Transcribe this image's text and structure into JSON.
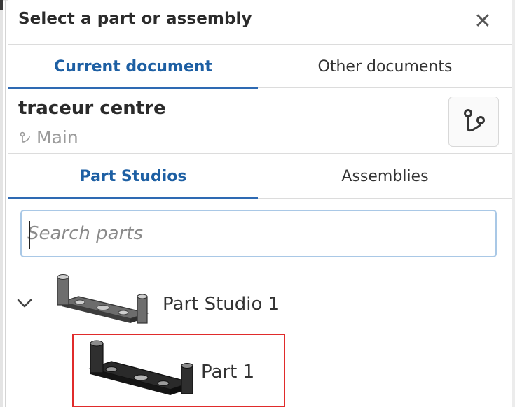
{
  "dialog": {
    "title": "Select a part or assembly",
    "close_symbol": "✕"
  },
  "document_tabs": [
    {
      "label": "Current document",
      "active": true
    },
    {
      "label": "Other documents",
      "active": false
    }
  ],
  "document": {
    "name": "traceur centre",
    "branch": "Main"
  },
  "element_tabs": [
    {
      "label": "Part Studios",
      "active": true
    },
    {
      "label": "Assemblies",
      "active": false
    }
  ],
  "search": {
    "placeholder": "Search parts",
    "value": ""
  },
  "tree": {
    "studio": {
      "label": "Part Studio 1",
      "expanded": true,
      "icon": "chevron-down-icon"
    },
    "parts": [
      {
        "label": "Part 1",
        "highlighted": true
      }
    ]
  },
  "colors": {
    "accent": "#2e6ab3",
    "accent_text": "#1d5fa3",
    "highlight_border": "#e02b2b",
    "search_border": "#a9c8e6"
  },
  "icons": [
    "close-icon",
    "branch-icon",
    "version-graph-icon",
    "chevron-down-icon"
  ]
}
